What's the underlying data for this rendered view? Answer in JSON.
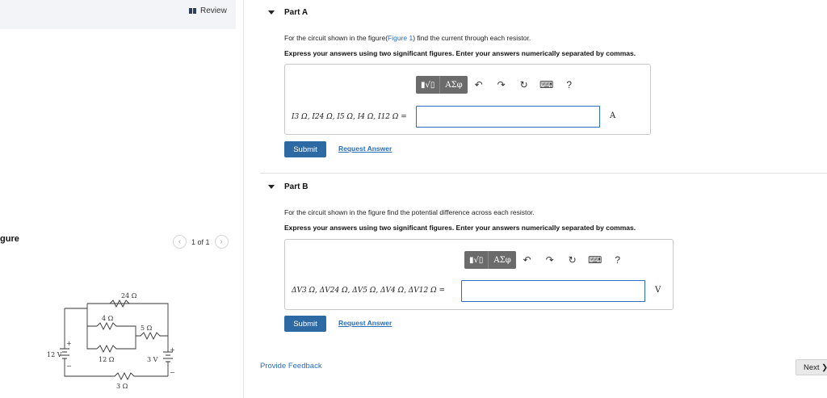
{
  "review": {
    "label": "Review"
  },
  "figure": {
    "title": "gure",
    "pager": {
      "text": "1 of 1"
    },
    "circuit": {
      "r24": "24 Ω",
      "r4": "4 Ω",
      "r5": "5 Ω",
      "r12": "12 Ω",
      "r3": "3 Ω",
      "v12": "12 V",
      "v3": "3 V",
      "plus": "+",
      "minus": "−"
    }
  },
  "partA": {
    "title": "Part A",
    "prompt_prefix": "For the circuit shown in the figure(",
    "figure_link": "Figure 1",
    "prompt_suffix": ") find the current through each resistor.",
    "instruction": "Express your answers using two significant figures. Enter your answers numerically separated by commas.",
    "equation_label": "I3 Ω, I24 Ω, I5 Ω, I4 Ω, I12 Ω =",
    "input_value": "",
    "unit": "A",
    "submit": "Submit",
    "request": "Request Answer"
  },
  "partB": {
    "title": "Part B",
    "prompt": "For the circuit shown in the figure find the potential difference across each resistor.",
    "instruction": "Express your answers using two significant figures. Enter your answers numerically separated by commas.",
    "equation_label": "ΔV3 Ω, ΔV24 Ω, ΔV5 Ω, ΔV4 Ω, ΔV12 Ω =",
    "input_value": "",
    "unit": "V",
    "submit": "Submit",
    "request": "Request Answer"
  },
  "toolbar": {
    "template": "▮√▯",
    "greek": "ΑΣφ",
    "undo": "↶",
    "redo": "↷",
    "reset": "↻",
    "keyboard": "⌨",
    "help": "?"
  },
  "footer": {
    "feedback": "Provide Feedback",
    "next": "Next ❯"
  }
}
